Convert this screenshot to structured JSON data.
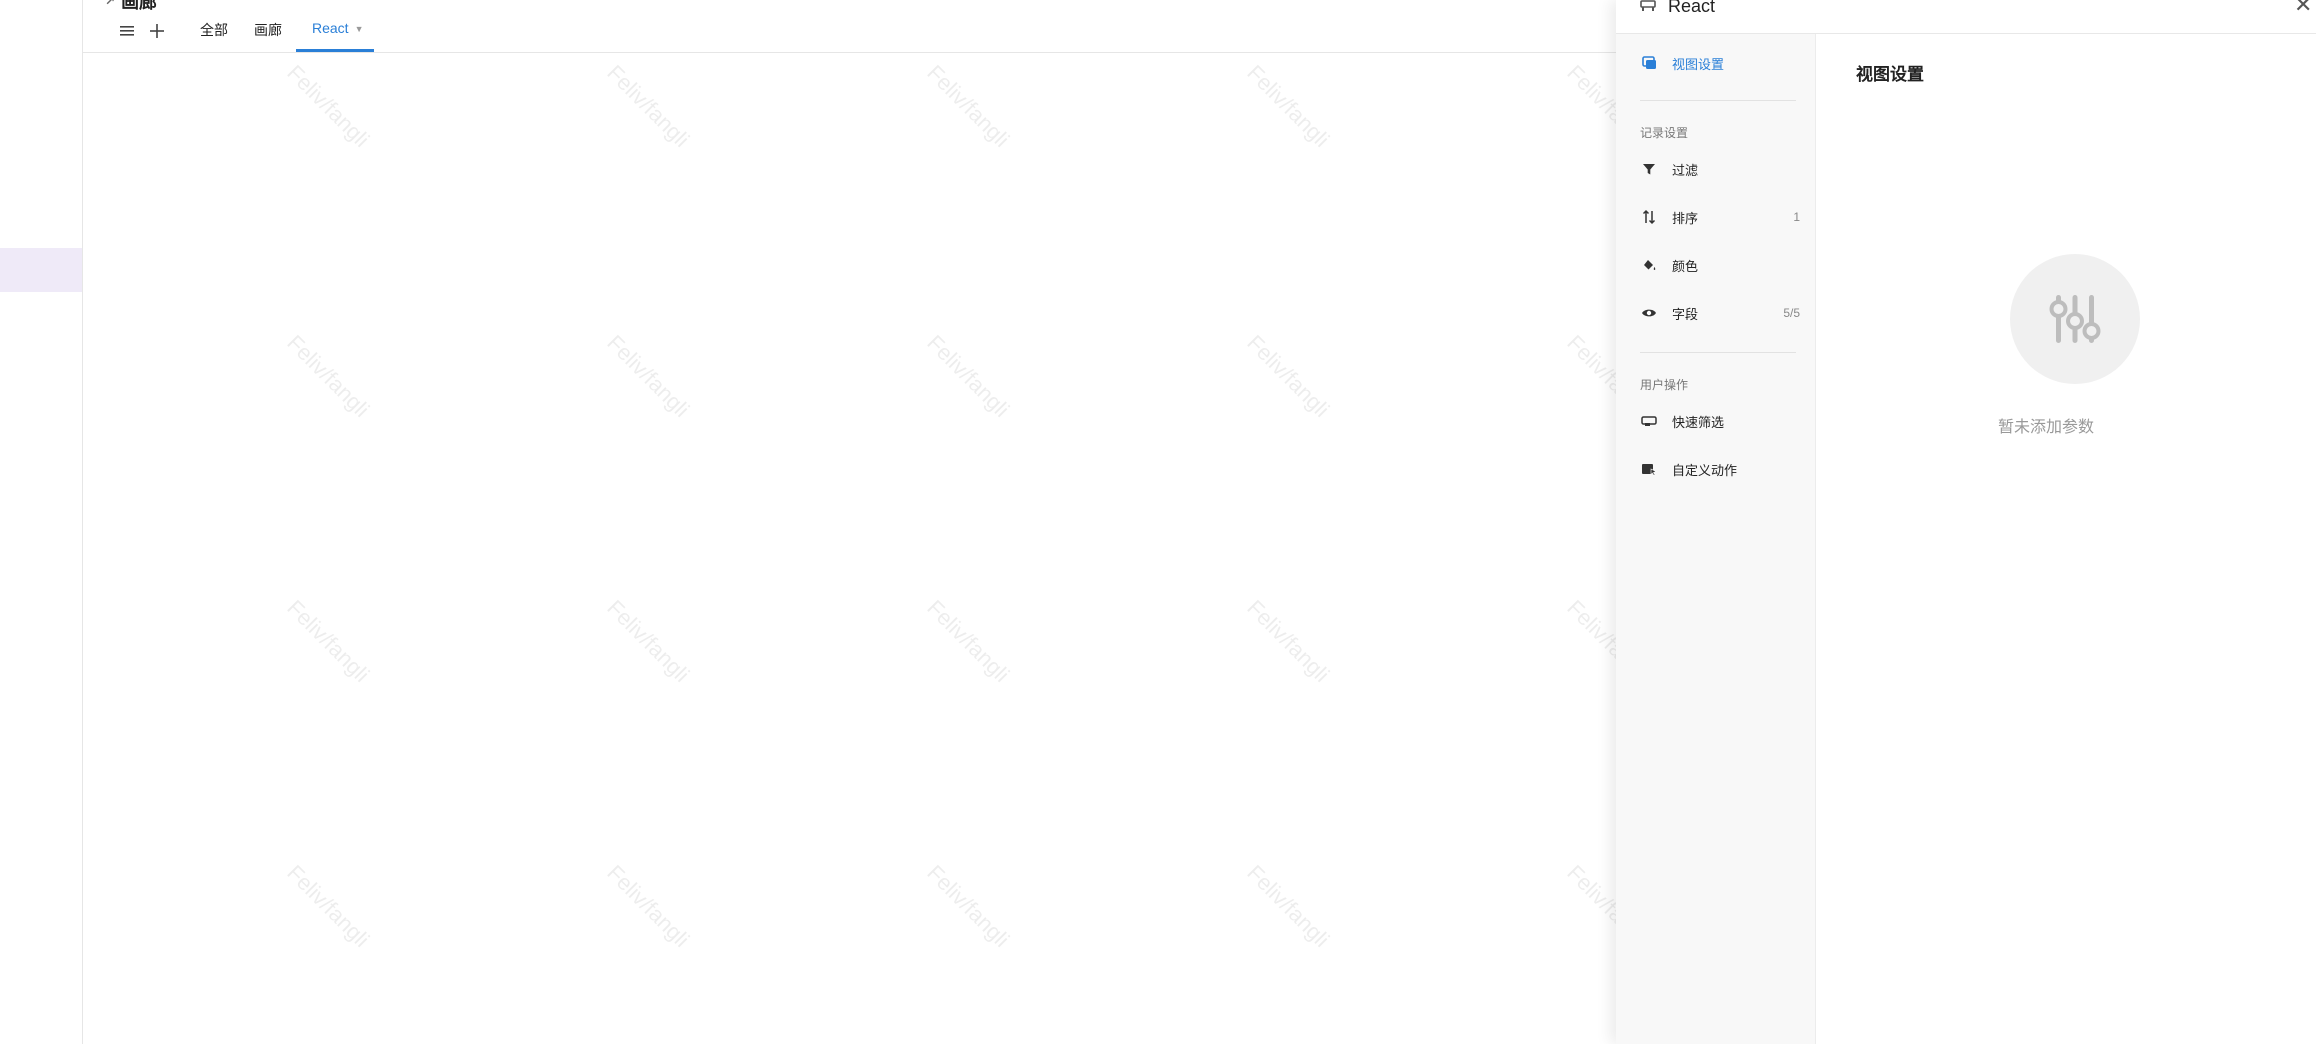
{
  "page": {
    "title": "画廊",
    "tabs": [
      {
        "label": "全部"
      },
      {
        "label": "画廊"
      },
      {
        "label": "React"
      }
    ],
    "watermark_text": "Feliv/fangli"
  },
  "panel": {
    "header_title": "React",
    "nav": {
      "view_settings": "视图设置",
      "record_section": "记录设置",
      "filter": "过滤",
      "sort": "排序",
      "sort_count": "1",
      "color": "颜色",
      "fields": "字段",
      "fields_count": "5/5",
      "user_section": "用户操作",
      "quick_filter": "快速筛选",
      "custom_action": "自定义动作"
    },
    "content": {
      "title": "视图设置",
      "empty_text": "暂未添加参数"
    }
  },
  "colors": {
    "accent": "#2a7fd7",
    "active_row": "#efeaf8"
  }
}
